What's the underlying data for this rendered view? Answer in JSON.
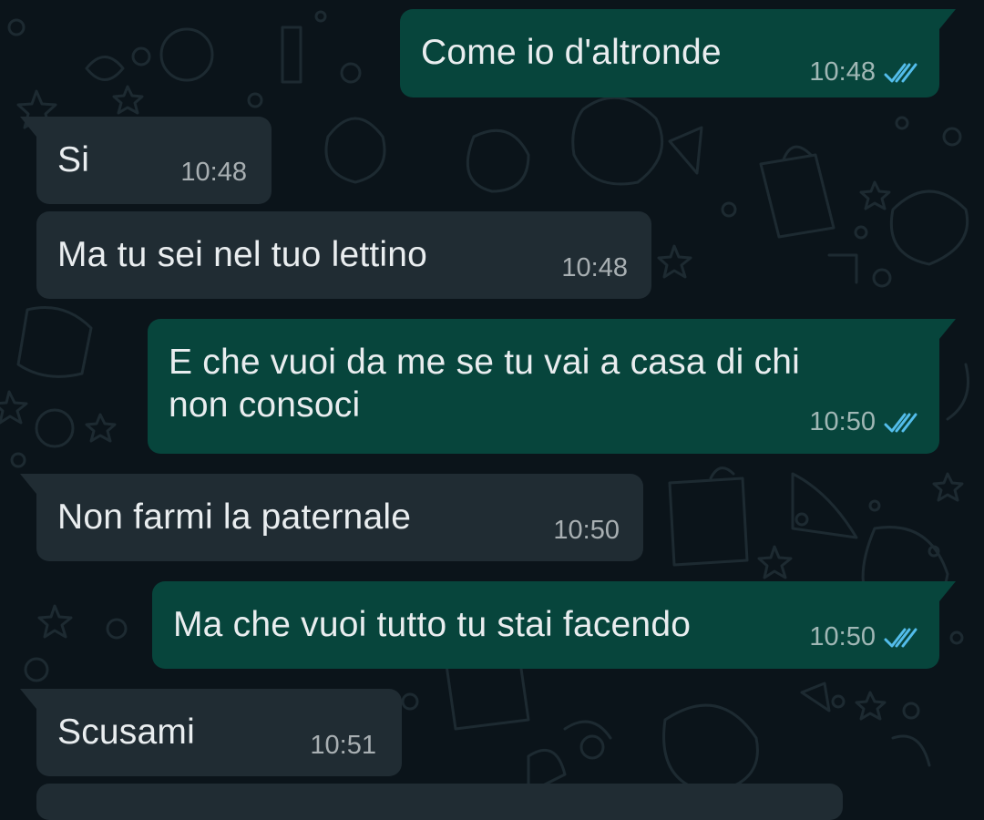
{
  "theme": {
    "background": "#0b141a",
    "incoming_bubble": "#202c33",
    "outgoing_bubble": "#07453c",
    "text": "#e9edef",
    "meta_text": "#aebac1",
    "read_ticks": "#53bdeb"
  },
  "messages": [
    {
      "direction": "outgoing",
      "text": "Come io d'altronde",
      "time": "10:48",
      "status": "read",
      "status_icon": "double-check-icon"
    },
    {
      "direction": "incoming",
      "text": "Si",
      "time": "10:48"
    },
    {
      "direction": "incoming",
      "text": "Ma tu sei nel tuo lettino",
      "time": "10:48"
    },
    {
      "direction": "outgoing",
      "text": "E che vuoi da me se tu vai a casa di chi\nnon consoci",
      "time": "10:50",
      "status": "read",
      "status_icon": "double-check-icon"
    },
    {
      "direction": "incoming",
      "text": "Non farmi la paternale",
      "time": "10:50"
    },
    {
      "direction": "outgoing",
      "text": "Ma che vuoi tutto tu stai facendo",
      "time": "10:50",
      "status": "read",
      "status_icon": "double-check-icon"
    },
    {
      "direction": "incoming",
      "text": "Scusami",
      "time": "10:51"
    }
  ]
}
